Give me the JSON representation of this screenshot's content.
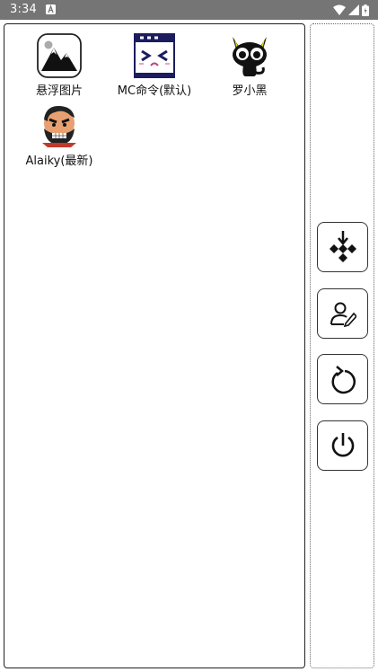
{
  "status_bar": {
    "time": "3:34"
  },
  "apps": [
    {
      "label": "悬浮图片"
    },
    {
      "label": "MC命令(默认)"
    },
    {
      "label": "罗小黑"
    },
    {
      "label": "Alaiky(最新)"
    }
  ],
  "side_buttons": [
    {
      "icon": "collapse-arrows-icon"
    },
    {
      "icon": "user-edit-icon"
    },
    {
      "icon": "refresh-icon"
    },
    {
      "icon": "power-icon"
    }
  ],
  "colors": {
    "status_bar": "#757575",
    "panel_border": "#222222"
  }
}
